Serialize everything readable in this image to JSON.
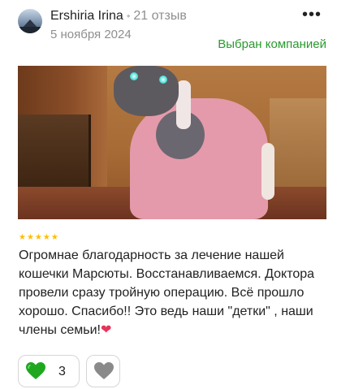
{
  "review": {
    "author": {
      "name": "Ershiria Irina",
      "reviews_count": "21 отзыв",
      "avatar_icon": "landscape-avatar"
    },
    "date": "5 ноября 2024",
    "more_icon": "ellipsis-icon",
    "badge": "Выбран компанией",
    "rating": {
      "value": 5,
      "max": 5,
      "stars": "★★★★★"
    },
    "text": "Огромнае благодарность за лечение нашей кошечки Марсюты. Восстанавливаемся. Доктора провели сразу тройную операцию. Всё прошло хорошо. Спасибо!! Это ведь наши \"детки\" , наши члены семьи!",
    "text_emoji": "❤",
    "photo_icon": "cat-photo",
    "reactions": {
      "like": {
        "icon": "green-heart-icon",
        "count": "3",
        "color": "#1fa81f"
      },
      "dislike": {
        "icon": "grey-heart-icon",
        "color": "#8a8a8a"
      }
    }
  },
  "colors": {
    "accent_green": "#2a9a2e",
    "star": "#ffbd00",
    "muted": "#8f8f8f"
  }
}
